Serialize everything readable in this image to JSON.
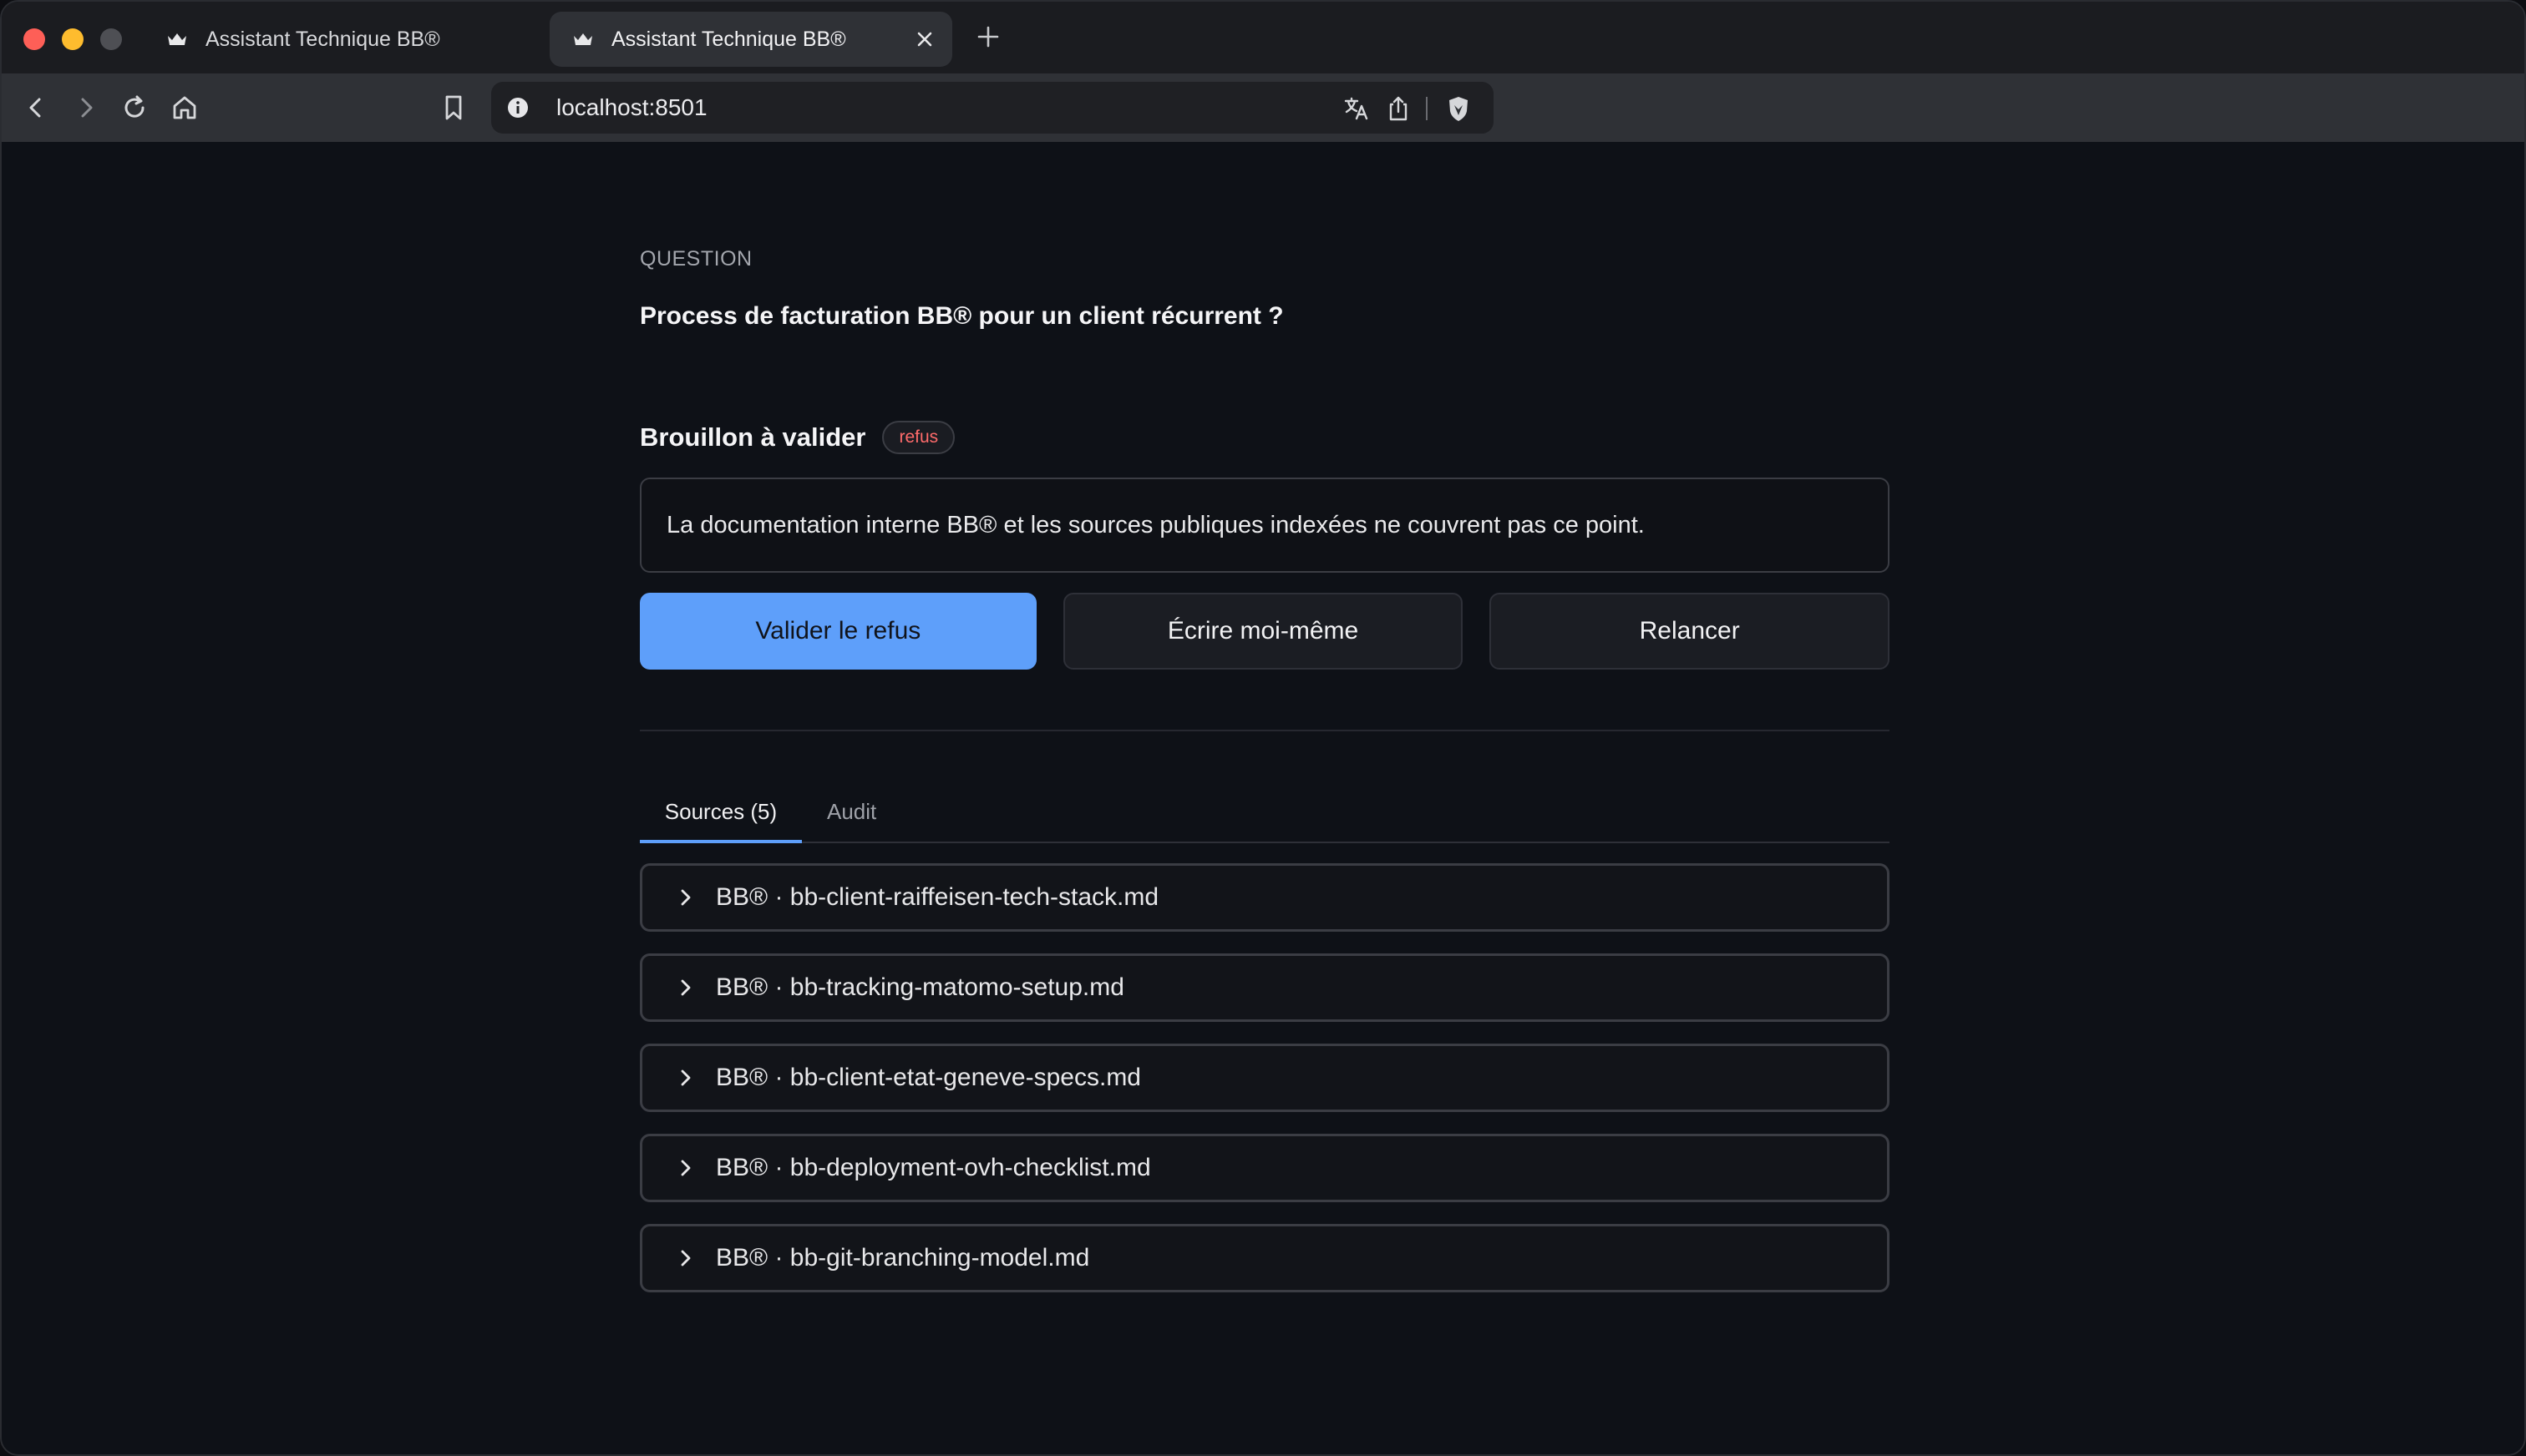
{
  "browser": {
    "tabs": [
      {
        "title": "Assistant Technique BB®",
        "active": false
      },
      {
        "title": "Assistant Technique BB®",
        "active": true
      }
    ],
    "url": "localhost:8501"
  },
  "page": {
    "question_label": "QUESTION",
    "question_text": "Process de facturation BB® pour un client récurrent ?",
    "draft_title": "Brouillon à valider",
    "draft_badge": "refus",
    "draft_text": "La documentation interne BB® et les sources publiques indexées ne couvrent pas ce point.",
    "actions": {
      "validate": "Valider le refus",
      "write": "Écrire moi-même",
      "retry": "Relancer"
    },
    "tabs": {
      "sources": "Sources (5)",
      "audit": "Audit"
    },
    "sources": [
      "BB® · bb-client-raiffeisen-tech-stack.md",
      "BB® · bb-tracking-matomo-setup.md",
      "BB® · bb-client-etat-geneve-specs.md",
      "BB® · bb-deployment-ovh-checklist.md",
      "BB® · bb-git-branching-model.md"
    ]
  },
  "colors": {
    "accent": "#5e9ffa",
    "badge_text": "#ff6b6b",
    "background": "#0e1117"
  }
}
